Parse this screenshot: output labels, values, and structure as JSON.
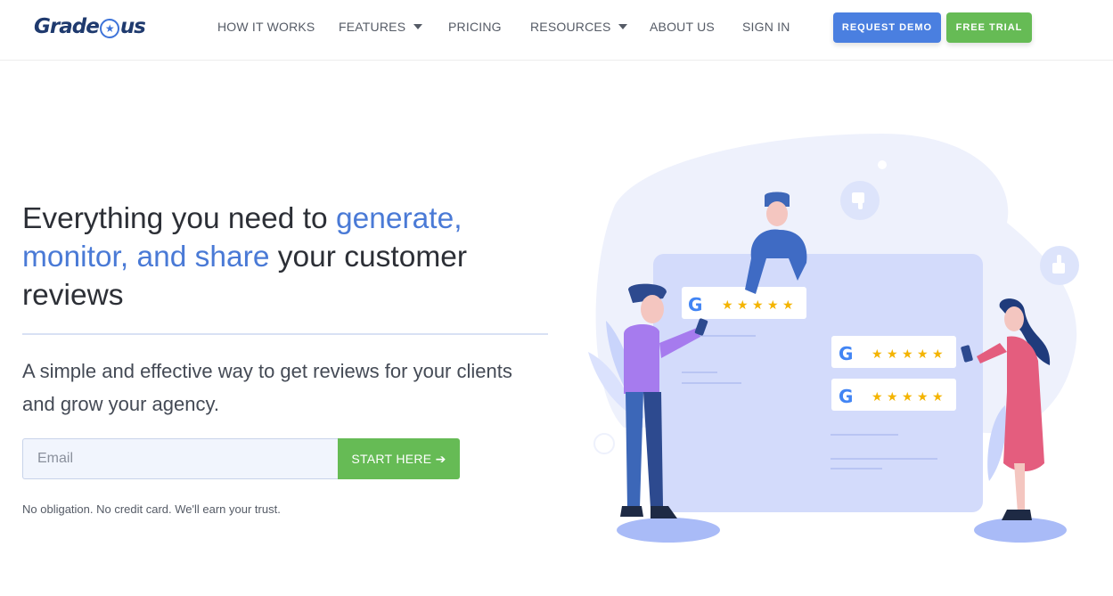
{
  "brand": {
    "logo_text_left": "Grade",
    "logo_text_right": "us",
    "logo_star": "★"
  },
  "nav": {
    "items": [
      {
        "label": "HOW IT WORKS"
      },
      {
        "label": "FEATURES"
      },
      {
        "label": "PRICING"
      },
      {
        "label": "RESOURCES"
      },
      {
        "label": "ABOUT US"
      },
      {
        "label": "SIGN IN"
      }
    ],
    "request_demo": "REQUEST DEMO",
    "free_trial": "FREE TRIAL"
  },
  "hero": {
    "headline_part1": "Everything you need to ",
    "headline_accent": "generate, monitor, and share",
    "headline_part2": " your customer reviews",
    "subhead": "A simple and effective way to get reviews for your clients and grow your agency.",
    "email_placeholder": "Email",
    "cta_label": "START HERE ➔",
    "fineprint": "No obligation. No credit card. We'll earn your trust."
  },
  "colors": {
    "accent_blue": "#4a7ad6",
    "demo_button": "#4a7fe0",
    "green": "#66bb55",
    "star_gold": "#f4b400"
  },
  "icons": {
    "caret": "chevron-down-icon",
    "thumb_down": "thumbs-down-icon",
    "thumb_up": "thumbs-up-icon",
    "google": "google-g-icon",
    "star": "star-icon"
  },
  "illustration": {
    "google_letter": "G",
    "review_cards": [
      {
        "rating": 5
      },
      {
        "rating": 5
      },
      {
        "rating": 5
      }
    ]
  }
}
